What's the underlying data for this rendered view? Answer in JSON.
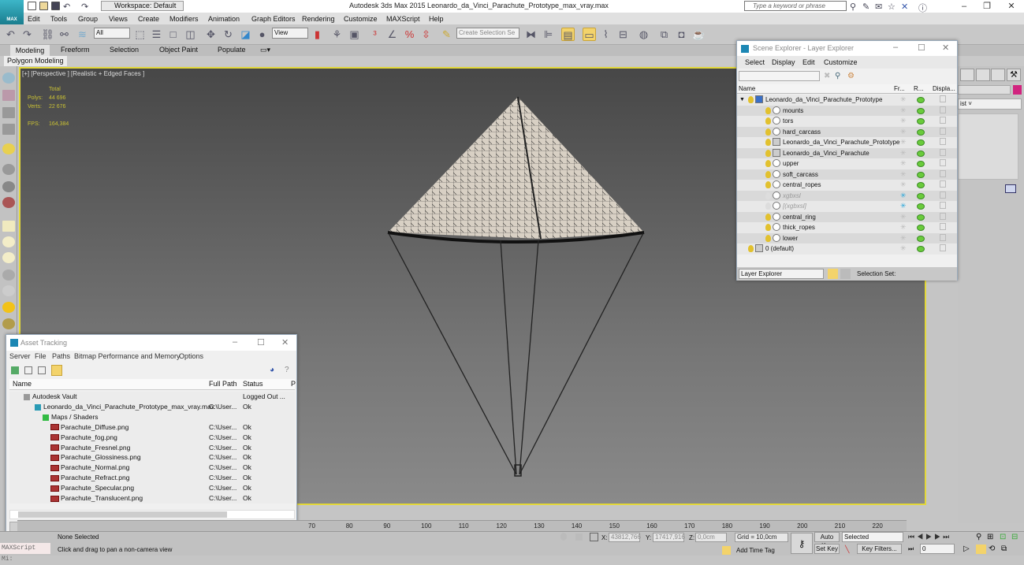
{
  "app": {
    "logo_label": "MAX",
    "window_title": "Autodesk 3ds Max  2015    Leonardo_da_Vinci_Parachute_Prototype_max_vray.max",
    "workspace": "Workspace: Default",
    "search_placeholder": "Type a keyword or phrase"
  },
  "menu": [
    "Edit",
    "Tools",
    "Group",
    "Views",
    "Create",
    "Modifiers",
    "Animation",
    "Graph Editors",
    "Rendering",
    "Customize",
    "MAXScript",
    "Help"
  ],
  "toolbar": {
    "selection_filter": "All",
    "reference_coord": "View",
    "named_selection_placeholder": "Create Selection Se"
  },
  "ribbon": {
    "tabs": [
      "Modeling",
      "Freeform",
      "Selection",
      "Object Paint",
      "Populate"
    ],
    "active_panel": "Polygon Modeling"
  },
  "viewport": {
    "label": "[+] [Perspective ] [Realistic + Edged Faces ]",
    "stats": {
      "total_label": "Total",
      "polys_label": "Polys:",
      "polys": "44 696",
      "verts_label": "Verts:",
      "verts": "22 676",
      "fps_label": "FPS:",
      "fps": "164,384"
    }
  },
  "scene_explorer": {
    "title": "Scene Explorer - Layer Explorer",
    "menu": [
      "Select",
      "Display",
      "Edit",
      "Customize"
    ],
    "columns": [
      "Name",
      "Fr...",
      "R...",
      "Displa..."
    ],
    "layers": [
      {
        "name": "Leonardo_da_Vinci_Parachute_Prototype",
        "level": 0,
        "icon": "layer",
        "frozen": false
      },
      {
        "name": "mounts",
        "level": 1,
        "icon": "object",
        "frozen": false
      },
      {
        "name": "tors",
        "level": 1,
        "icon": "object",
        "frozen": false
      },
      {
        "name": "hard_carcass",
        "level": 1,
        "icon": "object",
        "frozen": false
      },
      {
        "name": "Leonardo_da_Vinci_Parachute_Prototype",
        "level": 1,
        "icon": "group",
        "frozen": false
      },
      {
        "name": "Leonardo_da_Vinci_Parachute",
        "level": 1,
        "icon": "group",
        "frozen": false
      },
      {
        "name": "upper",
        "level": 1,
        "icon": "object",
        "frozen": false
      },
      {
        "name": "soft_carcass",
        "level": 1,
        "icon": "object",
        "frozen": false
      },
      {
        "name": "central_ropes",
        "level": 1,
        "icon": "object",
        "frozen": false
      },
      {
        "name": "xgbxsl",
        "level": 1,
        "icon": "hidden",
        "frozen": true
      },
      {
        "name": "[(xgbxsl]",
        "level": 1,
        "icon": "hidden",
        "frozen": true
      },
      {
        "name": "central_ring",
        "level": 1,
        "icon": "object",
        "frozen": false
      },
      {
        "name": "thick_ropes",
        "level": 1,
        "icon": "object",
        "frozen": false
      },
      {
        "name": "lower",
        "level": 1,
        "icon": "object",
        "frozen": false
      },
      {
        "name": "0 (default)",
        "level": 0,
        "icon": "default-layer",
        "frozen": false
      }
    ],
    "footer_mode": "Layer Explorer",
    "selection_set_label": "Selection Set:"
  },
  "asset_tracking": {
    "title": "Asset Tracking",
    "menu": [
      "Server",
      "File",
      "Paths",
      "Bitmap Performance and Memory",
      "Options"
    ],
    "columns": [
      "Name",
      "Full Path",
      "Status",
      "P"
    ],
    "rows": [
      {
        "name": "Autodesk Vault",
        "path": "",
        "status": "Logged Out ...",
        "level": 0,
        "icon": "vault"
      },
      {
        "name": "Leonardo_da_Vinci_Parachute_Prototype_max_vray.max",
        "path": "C:\\User...",
        "status": "Ok",
        "level": 1,
        "icon": "max"
      },
      {
        "name": "Maps / Shaders",
        "path": "",
        "status": "",
        "level": 2,
        "icon": "maps"
      },
      {
        "name": "Parachute_Diffuse.png",
        "path": "C:\\User...",
        "status": "Ok",
        "level": 3,
        "icon": "png"
      },
      {
        "name": "Parachute_fog.png",
        "path": "C:\\User...",
        "status": "Ok",
        "level": 3,
        "icon": "png"
      },
      {
        "name": "Parachute_Fresnel.png",
        "path": "C:\\User...",
        "status": "Ok",
        "level": 3,
        "icon": "png"
      },
      {
        "name": "Parachute_Glossiness.png",
        "path": "C:\\User...",
        "status": "Ok",
        "level": 3,
        "icon": "png"
      },
      {
        "name": "Parachute_Normal.png",
        "path": "C:\\User...",
        "status": "Ok",
        "level": 3,
        "icon": "png"
      },
      {
        "name": "Parachute_Refract.png",
        "path": "C:\\User...",
        "status": "Ok",
        "level": 3,
        "icon": "png"
      },
      {
        "name": "Parachute_Specular.png",
        "path": "C:\\User...",
        "status": "Ok",
        "level": 3,
        "icon": "png"
      },
      {
        "name": "Parachute_Translucent.png",
        "path": "C:\\User...",
        "status": "Ok",
        "level": 3,
        "icon": "png"
      }
    ]
  },
  "timeline": {
    "ticks": [
      "70",
      "80",
      "90",
      "100",
      "110",
      "120",
      "130",
      "140",
      "150",
      "160",
      "170",
      "180",
      "190",
      "200",
      "210",
      "220"
    ]
  },
  "status": {
    "maxscript_label": "MAXScript Mi:",
    "selection": "None Selected",
    "prompt": "Click and drag to pan a non-camera view",
    "x_label": "X:",
    "x": "43812,766",
    "y_label": "Y:",
    "y": "17417,916",
    "z_label": "Z:",
    "z": "0,0cm",
    "grid": "Grid = 10,0cm",
    "add_time_tag": "Add Time Tag",
    "auto_key": "Auto Key",
    "set_key": "Set Key",
    "key_mode": "Selected",
    "key_filters": "Key Filters...",
    "frame": "0"
  },
  "colors": {
    "viewport_border": "#e3d83a",
    "stats_text": "#c9c034",
    "highlight": "#f3d36b",
    "object_color": "#d1247f"
  }
}
